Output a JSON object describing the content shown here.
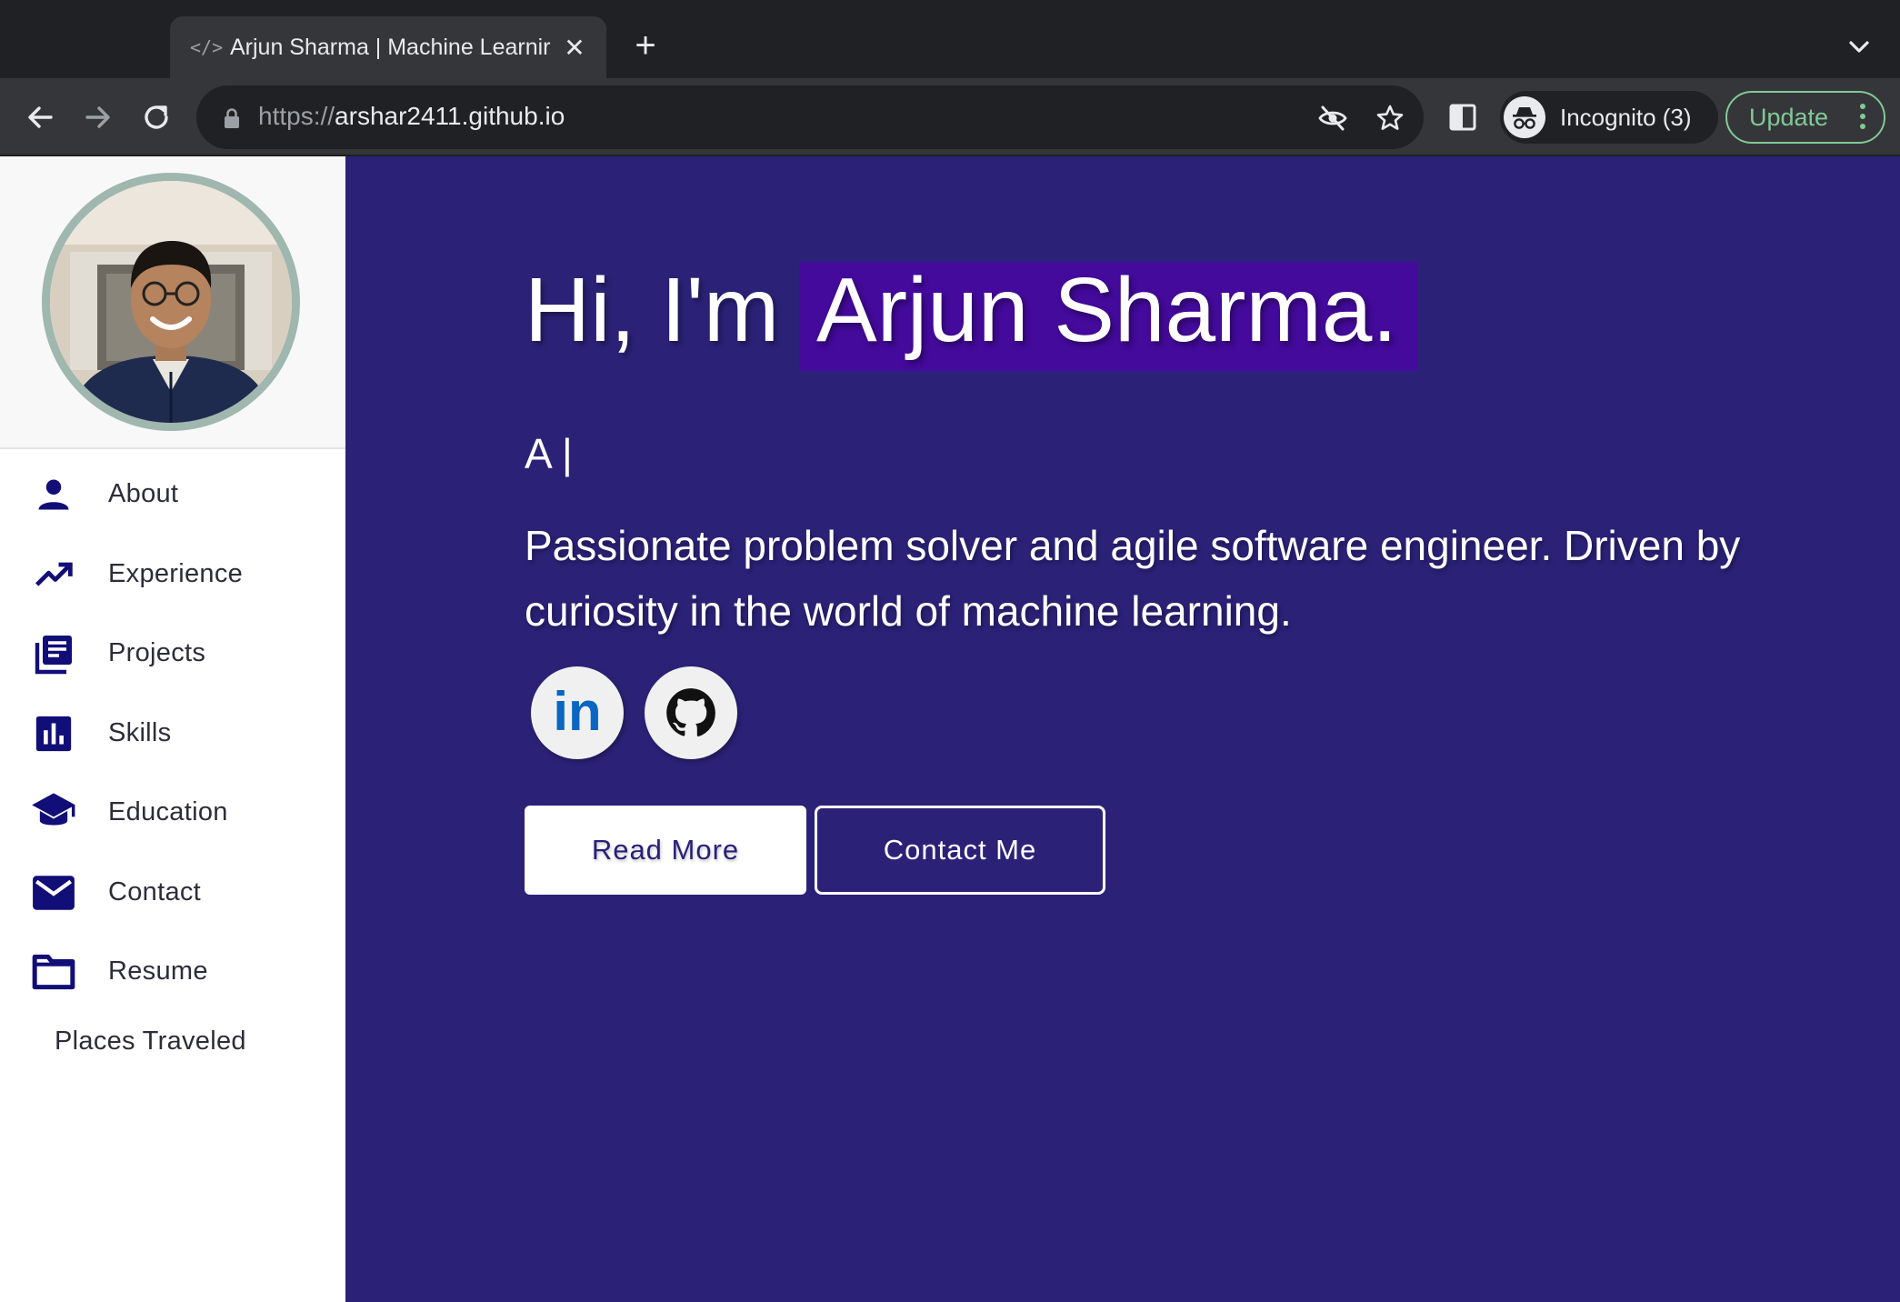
{
  "browser": {
    "tab": {
      "favicon_text": "</>",
      "title": "Arjun Sharma | Machine Learnir",
      "close_glyph": "✕"
    },
    "new_tab_glyph": "+",
    "url_scheme": "https://",
    "url_host": "arshar2411.github.io",
    "incognito_label": "Incognito (3)",
    "update_label": "Update",
    "icons": {
      "back": "arrow-back-icon",
      "forward": "arrow-forward-icon",
      "reload": "reload-icon",
      "lock": "lock-icon",
      "eye_off": "eye-off-icon",
      "star": "bookmark-star-icon",
      "side_panel": "side-panel-icon",
      "incognito": "incognito-icon",
      "menu": "kebab-menu-icon",
      "tab_search": "chevron-down-icon"
    },
    "colors": {
      "frame": "#202124",
      "toolbar": "#35363a",
      "update_accent": "#81c995"
    }
  },
  "sidebar": {
    "avatar_alt": "profile-photo",
    "items": [
      {
        "label": "About",
        "icon": "person-icon"
      },
      {
        "label": "Experience",
        "icon": "trending-up-icon"
      },
      {
        "label": "Projects",
        "icon": "library-books-icon"
      },
      {
        "label": "Skills",
        "icon": "bar-chart-icon"
      },
      {
        "label": "Education",
        "icon": "graduation-cap-icon"
      },
      {
        "label": "Contact",
        "icon": "mail-icon"
      },
      {
        "label": "Resume",
        "icon": "folder-icon"
      },
      {
        "label": "Places Traveled",
        "icon": ""
      }
    ],
    "icon_color": "#120e78"
  },
  "hero": {
    "greeting": "Hi, I'm",
    "name": "Arjun Sharma.",
    "typed_text": "A |",
    "tagline": "Passionate problem solver and agile software engineer. Driven by curiosity in the world of machine learning.",
    "social": [
      {
        "name": "linkedin-icon",
        "text": "in"
      },
      {
        "name": "github-icon"
      }
    ],
    "buttons": {
      "read_more": "Read More",
      "contact_me": "Contact Me"
    },
    "colors": {
      "background": "#2b2278",
      "name_highlight": "#430a9b",
      "linkedin": "#0a66c2"
    }
  }
}
